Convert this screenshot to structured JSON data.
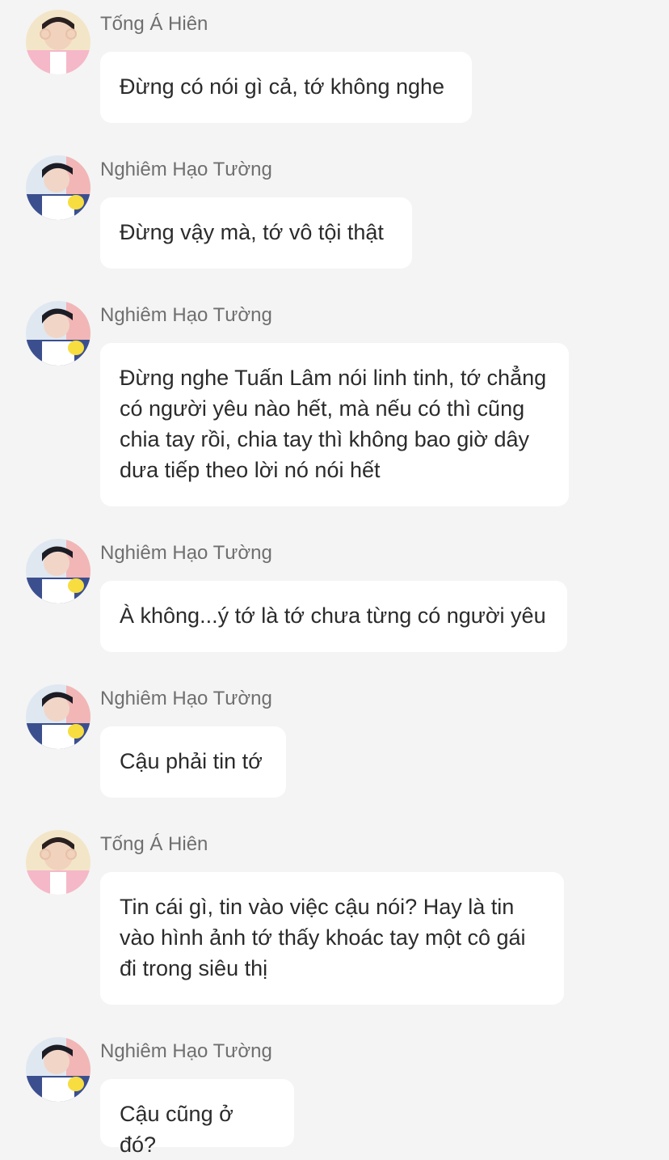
{
  "chat": {
    "messages": [
      {
        "sender": "Tống Á Hiên",
        "avatar": "avatar-tong-a-hien",
        "text": "Đừng có nói gì cả, tớ không nghe"
      },
      {
        "sender": "Nghiêm Hạo Tường",
        "avatar": "avatar-nghiem-hao-tuong",
        "text": "Đừng vậy mà, tớ vô tội thật"
      },
      {
        "sender": "Nghiêm Hạo Tường",
        "avatar": "avatar-nghiem-hao-tuong",
        "text": "Đừng nghe Tuấn Lâm nói linh tinh, tớ chẳng có người yêu nào hết, mà nếu có thì cũng chia tay rồi, chia tay thì không bao giờ dây dưa tiếp theo lời nó nói hết"
      },
      {
        "sender": "Nghiêm Hạo Tường",
        "avatar": "avatar-nghiem-hao-tuong",
        "text": "À không...ý tớ là tớ chưa từng có người yêu"
      },
      {
        "sender": "Nghiêm Hạo Tường",
        "avatar": "avatar-nghiem-hao-tuong",
        "text": "Cậu phải tin tớ"
      },
      {
        "sender": "Tống Á Hiên",
        "avatar": "avatar-tong-a-hien",
        "text": "Tin cái gì, tin vào việc cậu nói? Hay là tin vào hình ảnh tớ thấy khoác tay một cô gái đi trong siêu thị"
      },
      {
        "sender": "Nghiêm Hạo Tường",
        "avatar": "avatar-nghiem-hao-tuong",
        "text": "Cậu cũng ở đó?"
      }
    ]
  },
  "colors": {
    "background": "#f4f4f4",
    "bubble": "#ffffff",
    "sender_name": "#6f6f6f",
    "message_text": "#2b2b2b"
  }
}
